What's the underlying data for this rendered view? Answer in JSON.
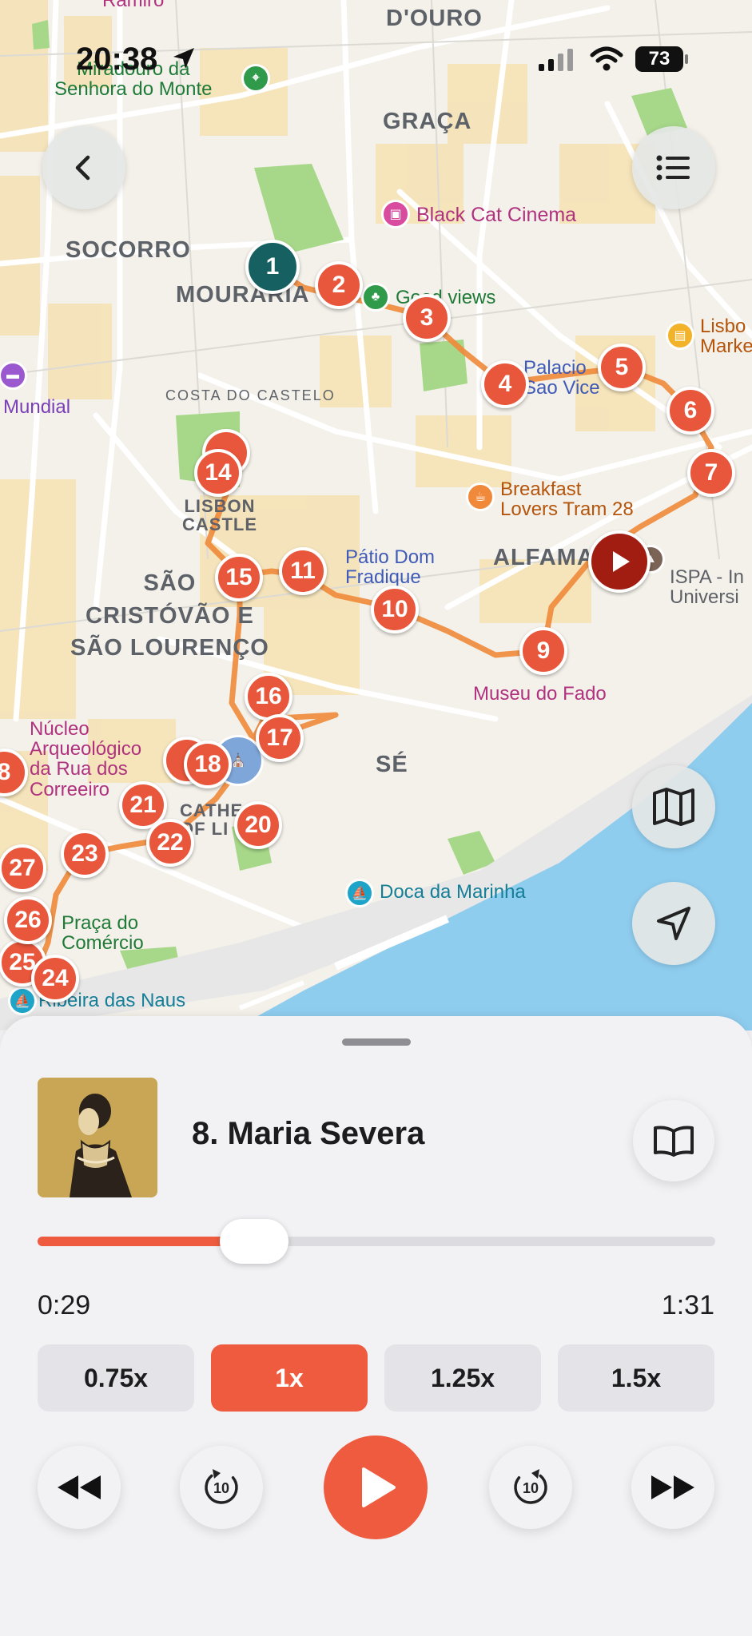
{
  "status_bar": {
    "time": "20:38",
    "battery": "73"
  },
  "map": {
    "districts": [
      "D'OURO",
      "GRAÇA",
      "SOCORRO",
      "MOURARIA",
      "ALFAMA",
      "SÃO\nCRISTÓVÃO E\nSÃO LOURENÇO",
      "SÉ"
    ],
    "pois": {
      "miradouro": "Miradouro da\nSenhora do Monte",
      "ramiro": "Ramiro",
      "black_cat": "Black Cat Cinema",
      "good_views": "Good views",
      "palacio": "Palacio\nSao Vice",
      "lisboa_market": "Lisbo\nMarke",
      "mundial": "Mundial",
      "breakfast": "Breakfast\nLovers Tram 28",
      "lisbon_castle": "LISBON\nCASTLE",
      "patio": "Pátio Dom\nFradique",
      "ispa": "ISPA - In\nUniversi",
      "museu_fado": "Museu do Fado",
      "nucleo": "Núcleo\nArqueológico\nda Rua dos\nCorreeiro",
      "cathedral": "CATHE\nOF LI",
      "doca": "Doca da Marinha",
      "praca": "Praça do\nComércio",
      "ribeira": "Ribeira das Naus",
      "costa_castelo": "COSTA DO CASTELO"
    },
    "stops": [
      "1",
      "2",
      "3",
      "4",
      "5",
      "6",
      "7",
      "9",
      "10",
      "11",
      "14",
      "15",
      "16",
      "17",
      "18",
      "20",
      "21",
      "22",
      "23",
      "24",
      "26",
      "27",
      "8",
      "25"
    ]
  },
  "player": {
    "title": "8. Maria Severa",
    "elapsed": "0:29",
    "duration": "1:31",
    "progress": 0.32,
    "speeds": [
      "0.75x",
      "1x",
      "1.25x",
      "1.5x"
    ],
    "active_speed": "1x",
    "skip_back": "10",
    "skip_forward": "10"
  },
  "colors": {
    "accent": "#ee5b3e",
    "start_pin": "#176061",
    "current_pin": "#a11d12",
    "water": "#8fcdef"
  }
}
